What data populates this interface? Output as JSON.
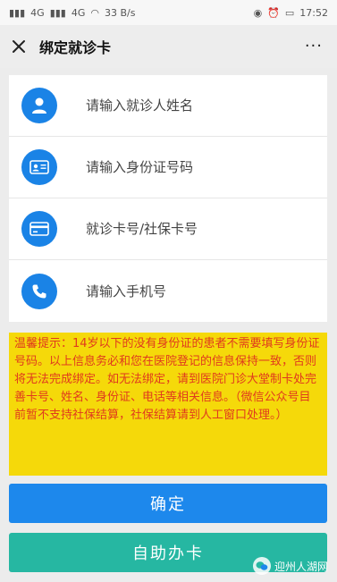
{
  "status_bar": {
    "network": "4G",
    "network2": "4G",
    "speed": "33 B/s",
    "time": "17:52"
  },
  "nav": {
    "title": "绑定就诊卡",
    "more": "···"
  },
  "form": {
    "name_placeholder": "请输入就诊人姓名",
    "idcard_placeholder": "请输入身份证号码",
    "card_placeholder": "就诊卡号/社保卡号",
    "phone_placeholder": "请输入手机号"
  },
  "notice": {
    "text": "温馨提示：14岁以下的没有身份证的患者不需要填写身份证号码。以上信息务必和您在医院登记的信息保持一致，否则将无法完成绑定。如无法绑定，请到医院门诊大堂制卡处完善卡号、姓名、身份证、电话等相关信息。（微信公众号目前暂不支持社保结算，社保结算请到人工窗口处理。）"
  },
  "buttons": {
    "confirm": "确定",
    "self_service": "自助办卡"
  },
  "watermark": {
    "text": "迎州人湖网"
  },
  "colors": {
    "primary_blue": "#1d88ec",
    "teal": "#26b7a2",
    "notice_bg": "#f5d90a",
    "notice_text": "#e03a1e"
  }
}
